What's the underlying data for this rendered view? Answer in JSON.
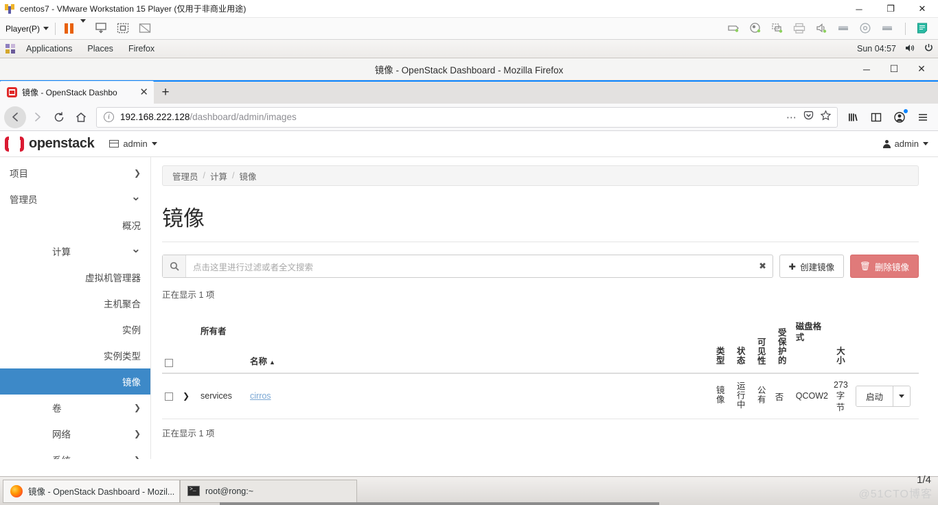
{
  "vmware": {
    "title": "centos7 - VMware Workstation 15 Player (仅用于非商业用途)",
    "app_icon": "vmware-icon",
    "window_buttons": [
      {
        "name": "minimize-button",
        "glyph": "─"
      },
      {
        "name": "maximize-button",
        "glyph": "❐"
      },
      {
        "name": "close-button",
        "glyph": "✕"
      }
    ],
    "toolbar": {
      "player_menu": "Player(P)",
      "icons": [
        "pause-icon",
        "pause-dropdown-icon",
        "send-ctrl-alt-del-icon",
        "unity-mode-icon",
        "fullscreen-icon",
        "disconnect-icon"
      ],
      "right_icons": [
        "network-icon",
        "usb-icon",
        "cd-dvd-icon",
        "printer-icon",
        "sound-icon",
        "removable-device-icon",
        "hard-disk-icon",
        "removable-device2-icon",
        "notes-icon"
      ]
    }
  },
  "gnome": {
    "applications": "Applications",
    "places": "Places",
    "firefox": "Firefox",
    "clock": "Sun 04:57",
    "volume_icon": "volume-icon",
    "power_icon": "power-icon"
  },
  "firefox": {
    "window_title": "镜像 - OpenStack Dashboard - Mozilla Firefox",
    "window_buttons": [
      {
        "name": "ff-minimize-button",
        "glyph": "─"
      },
      {
        "name": "ff-maximize-button",
        "glyph": "☐"
      },
      {
        "name": "ff-close-button",
        "glyph": "✕"
      }
    ],
    "tab": {
      "label": "镜像 - OpenStack Dashbo",
      "close_glyph": "✕",
      "favicon": "openstack-favicon"
    },
    "new_tab_glyph": "+",
    "nav": {
      "back_glyph": "←",
      "forward_glyph": "→",
      "reload_glyph": "↻",
      "home_glyph": "⌂"
    },
    "url": {
      "host": "192.168.222.128",
      "path": "/dashboard/admin/images",
      "info_glyph": "i",
      "page_actions_glyph": "⋯",
      "pocket_icon": "pocket-icon",
      "bookmark_icon": "star-icon"
    },
    "right_icons": [
      "library-icon",
      "sidebar-icon",
      "account-icon",
      "menu-icon"
    ]
  },
  "dashboard": {
    "brand": "openstack",
    "project_selector": "admin",
    "user_menu": "admin",
    "sidebar": [
      {
        "label": "项目",
        "level": 0,
        "chevron": "right",
        "active": false
      },
      {
        "label": "管理员",
        "level": 0,
        "chevron": "down",
        "active": false
      },
      {
        "label": "概况",
        "level": 2,
        "chevron": "none",
        "active": false
      },
      {
        "label": "计算",
        "level": 1,
        "chevron": "down",
        "active": false
      },
      {
        "label": "虚拟机管理器",
        "level": 2,
        "chevron": "none",
        "active": false
      },
      {
        "label": "主机聚合",
        "level": 2,
        "chevron": "none",
        "active": false
      },
      {
        "label": "实例",
        "level": 2,
        "chevron": "none",
        "active": false
      },
      {
        "label": "实例类型",
        "level": 2,
        "chevron": "none",
        "active": false
      },
      {
        "label": "镜像",
        "level": 2,
        "chevron": "none",
        "active": true
      },
      {
        "label": "卷",
        "level": 1,
        "chevron": "right",
        "active": false
      },
      {
        "label": "网络",
        "level": 1,
        "chevron": "right",
        "active": false
      },
      {
        "label": "系统",
        "level": 1,
        "chevron": "right",
        "active": false
      }
    ],
    "breadcrumb": [
      "管理员",
      "计算",
      "镜像"
    ],
    "breadcrumb_sep": "/",
    "page_title": "镜像",
    "filter": {
      "placeholder": "点击这里进行过滤或者全文搜索",
      "value": "",
      "search_icon": "search-icon",
      "clear_glyph": "✖"
    },
    "actions": {
      "create_label": "创建镜像",
      "create_glyph": "✚",
      "delete_label": "删除镜像",
      "delete_glyph": "🗑"
    },
    "count_top": "正在显示 1 项",
    "count_bottom": "正在显示 1 项",
    "table": {
      "columns": [
        {
          "label": "",
          "key": "select",
          "vertical": false
        },
        {
          "label": "",
          "key": "expand",
          "vertical": false
        },
        {
          "label": "所有者",
          "key": "owner",
          "vertical": false
        },
        {
          "label": "名称",
          "key": "name",
          "vertical": false,
          "sort": "▲"
        },
        {
          "label": "类型",
          "key": "type",
          "vertical": true
        },
        {
          "label": "状态",
          "key": "status",
          "vertical": true
        },
        {
          "label": "可见性",
          "key": "visibility",
          "vertical": true
        },
        {
          "label": "受保护的",
          "key": "protected",
          "vertical": true
        },
        {
          "label": "磁盘格式",
          "key": "disk_format",
          "vertical": true
        },
        {
          "label": "大小",
          "key": "size",
          "vertical": true
        },
        {
          "label": "",
          "key": "actions",
          "vertical": false
        }
      ],
      "rows": [
        {
          "owner": "services",
          "name": "cirros",
          "type": "镜像",
          "status": "运行中",
          "visibility": "公有",
          "protected": "否",
          "disk_format": "QCOW2",
          "size": "273 字节",
          "action_label": "启动",
          "action_caret": "▼",
          "expand_glyph": "❯"
        }
      ]
    }
  },
  "taskbar": {
    "items": [
      {
        "label": "镜像 - OpenStack Dashboard - Mozil...",
        "icon": "firefox-icon",
        "active": true
      },
      {
        "label": "root@rong:~",
        "icon": "terminal-icon",
        "active": false
      }
    ],
    "page_indicator": "1/4",
    "watermark": "@51CTO博客"
  },
  "colors": {
    "accent": "#3d89c8",
    "danger": "#e07a7a",
    "brand_red": "#da1a32",
    "link": "#7aa7d4"
  }
}
